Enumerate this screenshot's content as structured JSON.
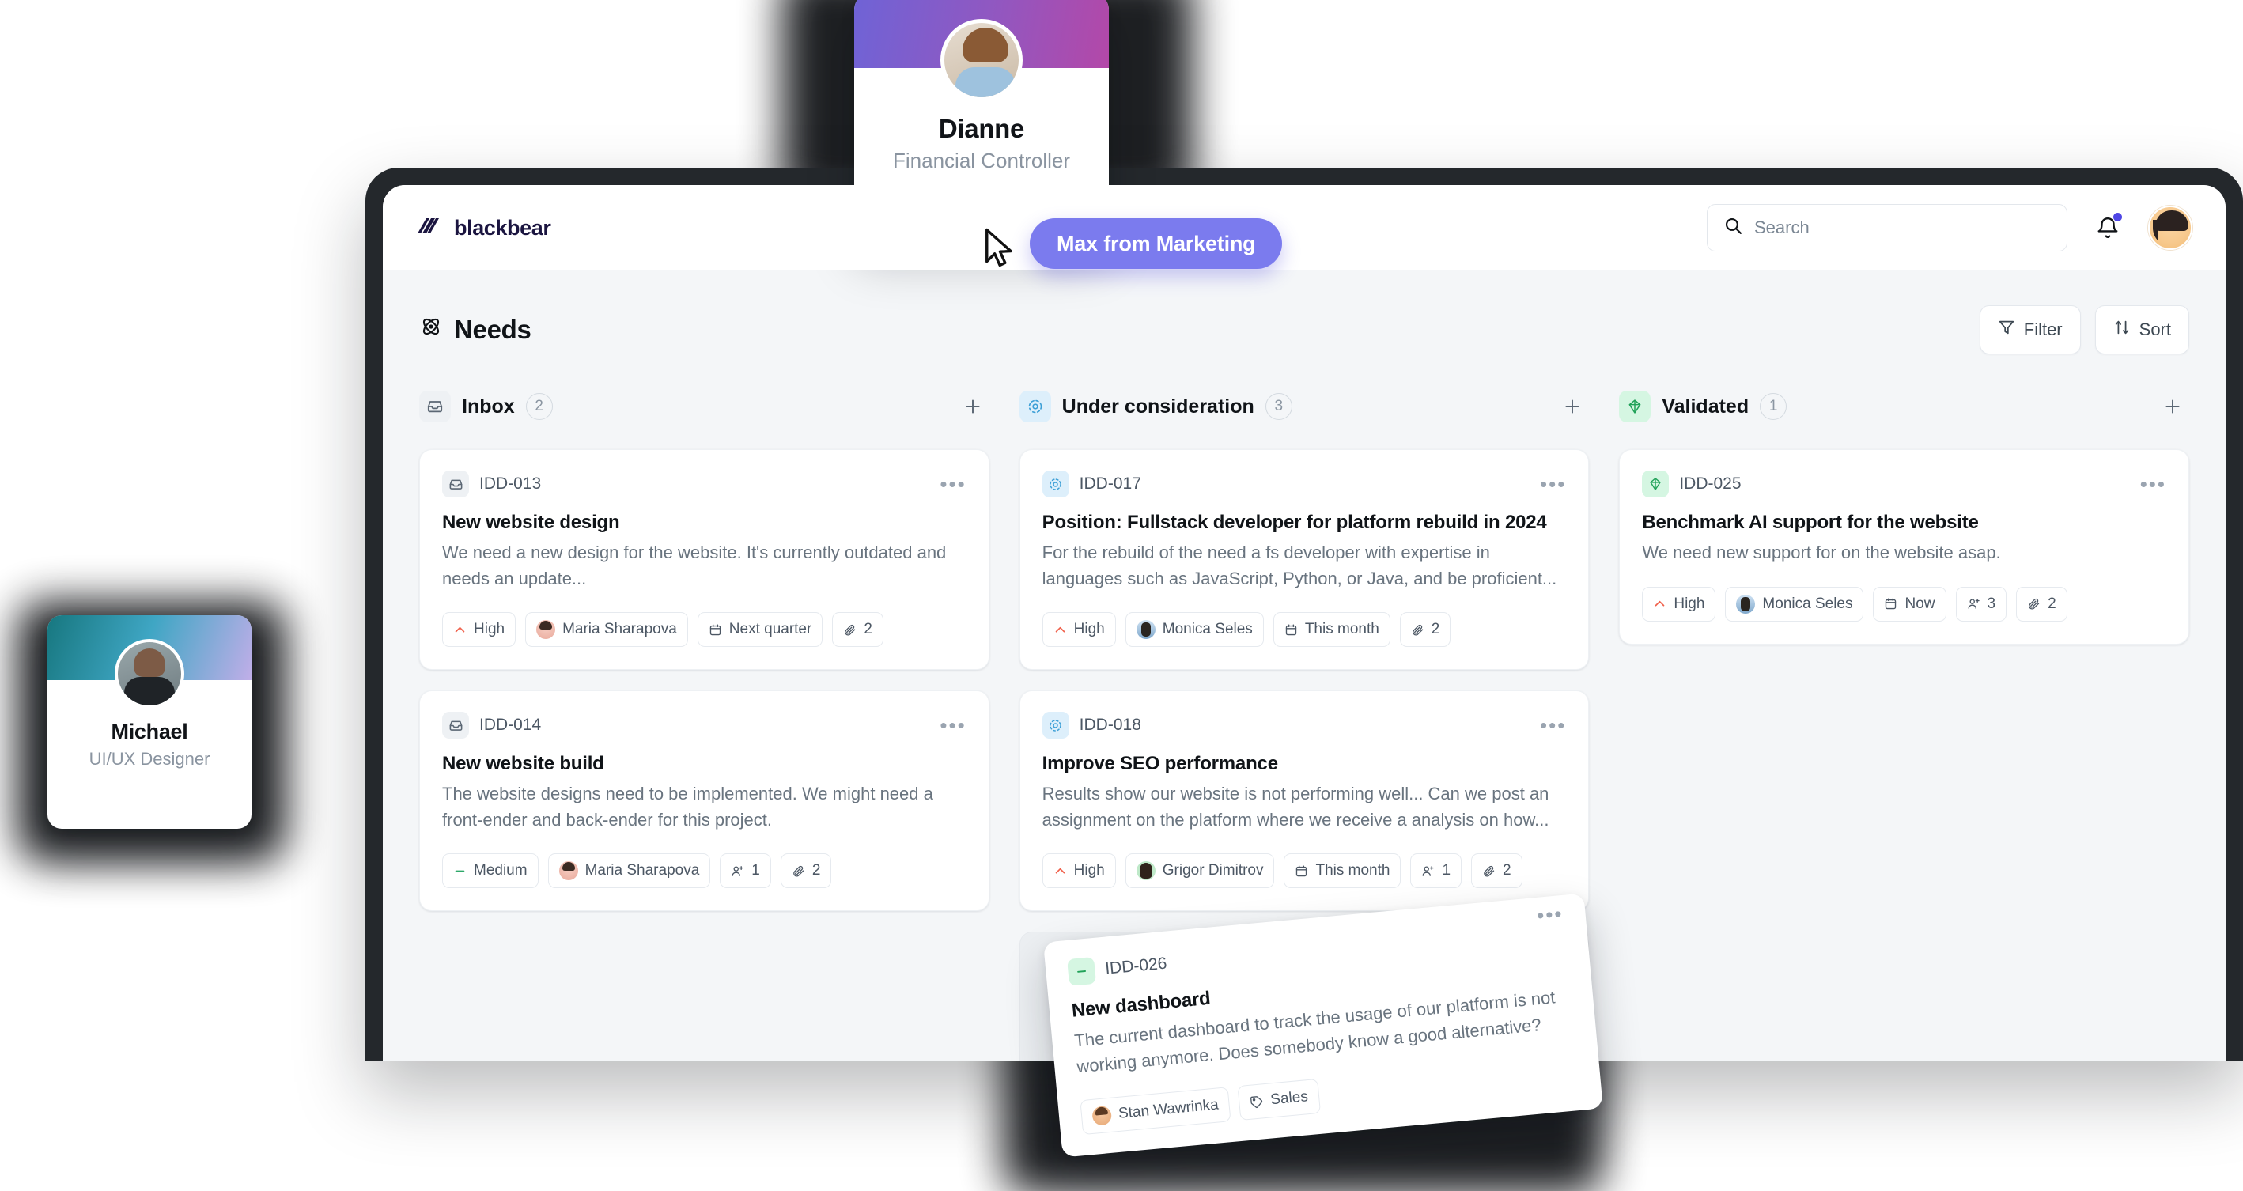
{
  "app": {
    "logo_text": "blackbear",
    "logo_icon": "slashes-logo-icon"
  },
  "topbar": {
    "search_placeholder": "Search",
    "search_value": "",
    "search_icon": "search-icon",
    "notification_icon": "bell-icon",
    "avatar_icon": "user-avatar"
  },
  "board": {
    "title": "Needs",
    "title_icon": "atom-icon",
    "filter_label": "Filter",
    "filter_icon": "filter-icon",
    "sort_label": "Sort",
    "sort_icon": "sort-arrows-icon",
    "add_icon": "plus-icon",
    "menu_icon": "ellipsis-icon"
  },
  "columns": [
    {
      "name": "Inbox",
      "count": "2",
      "icon": "inbox-icon",
      "cards": [
        {
          "id": "IDD-013",
          "badge_icon": "inbox-icon",
          "title": "New website design",
          "description": "We need a new design for the website. It's currently outdated and needs an update...",
          "chips": [
            {
              "type": "priority",
              "label": "High",
              "icon": "chevron-up-icon"
            },
            {
              "type": "assignee",
              "label": "Maria Sharapova",
              "icon": "avatar-maria"
            },
            {
              "type": "date",
              "label": "Next quarter",
              "icon": "calendar-icon"
            },
            {
              "type": "attachments",
              "label": "2",
              "icon": "paperclip-icon"
            }
          ]
        },
        {
          "id": "IDD-014",
          "badge_icon": "inbox-icon",
          "title": "New website build",
          "description": "The website designs need to be implemented. We might need a front-ender and back-ender for this project.",
          "chips": [
            {
              "type": "priority",
              "label": "Medium",
              "icon": "dash-icon"
            },
            {
              "type": "assignee",
              "label": "Maria Sharapova",
              "icon": "avatar-maria"
            },
            {
              "type": "people",
              "label": "1",
              "icon": "add-person-icon"
            },
            {
              "type": "attachments",
              "label": "2",
              "icon": "paperclip-icon"
            }
          ]
        }
      ]
    },
    {
      "name": "Under consideration",
      "count": "3",
      "icon": "consideration-icon",
      "cards": [
        {
          "id": "IDD-017",
          "badge_icon": "consideration-icon",
          "title": "Position: Fullstack developer for platform rebuild in 2024",
          "description": "For the rebuild of the need a fs developer with expertise in languages such as JavaScript, Python, or Java, and be proficient...",
          "chips": [
            {
              "type": "priority",
              "label": "High",
              "icon": "chevron-up-icon"
            },
            {
              "type": "assignee",
              "label": "Monica Seles",
              "icon": "avatar-monica"
            },
            {
              "type": "date",
              "label": "This month",
              "icon": "calendar-icon"
            },
            {
              "type": "attachments",
              "label": "2",
              "icon": "paperclip-icon"
            }
          ]
        },
        {
          "id": "IDD-018",
          "badge_icon": "consideration-icon",
          "title": "Improve SEO performance",
          "description": "Results show our website is not performing well... Can we post an assignment on the platform where we receive a analysis on how...",
          "chips": [
            {
              "type": "priority",
              "label": "High",
              "icon": "chevron-up-icon"
            },
            {
              "type": "assignee",
              "label": "Grigor Dimitrov",
              "icon": "avatar-grigor"
            },
            {
              "type": "date",
              "label": "This month",
              "icon": "calendar-icon"
            },
            {
              "type": "people",
              "label": "1",
              "icon": "add-person-icon"
            },
            {
              "type": "attachments",
              "label": "2",
              "icon": "paperclip-icon"
            }
          ]
        }
      ]
    },
    {
      "name": "Validated",
      "count": "1",
      "icon": "diamond-icon",
      "cards": [
        {
          "id": "IDD-025",
          "badge_icon": "diamond-icon",
          "title": "Benchmark AI support for the website",
          "description": "We need new support for on the website asap.",
          "chips": [
            {
              "type": "priority",
              "label": "High",
              "icon": "chevron-up-icon"
            },
            {
              "type": "assignee",
              "label": "Monica Seles",
              "icon": "avatar-monica"
            },
            {
              "type": "date",
              "label": "Now",
              "icon": "calendar-icon"
            },
            {
              "type": "people",
              "label": "3",
              "icon": "add-person-icon"
            },
            {
              "type": "attachments",
              "label": "2",
              "icon": "paperclip-icon"
            }
          ]
        }
      ]
    }
  ],
  "dragged_card": {
    "id": "IDD-026",
    "badge_icon": "minus-icon",
    "title": "New dashboard",
    "description": "The current dashboard to track the usage of our platform is not working anymore. Does somebody know a good alternative?",
    "menu_icon": "ellipsis-icon",
    "chips": [
      {
        "type": "assignee",
        "label": "Stan Wawrinka",
        "icon": "avatar-stan"
      },
      {
        "type": "tag",
        "label": "Sales",
        "icon": "tag-icon"
      }
    ]
  },
  "profile_cards": [
    {
      "name": "Dianne",
      "role": "Financial Controller",
      "banner_from": "#6f63d6",
      "banner_to": "#b348a8"
    },
    {
      "name": "Michael",
      "role": "UI/UX Designer",
      "banner_from": "#17777f",
      "banner_to": "#c0aee8"
    }
  ],
  "cursor_label": {
    "text": "Max from Marketing",
    "color": "#7b7bee"
  },
  "colors": {
    "accent": "#7b7bee",
    "brand_dark": "#1b1540",
    "priority_high": "#f0624d",
    "priority_medium": "#2ea86a",
    "board_bg": "#f4f6f8",
    "device_frame": "#24282c"
  }
}
